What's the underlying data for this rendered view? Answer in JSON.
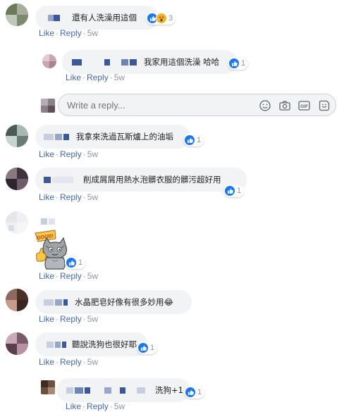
{
  "actions": {
    "like": "Like",
    "reply": "Reply"
  },
  "reply_box": {
    "placeholder": "Write a reply..."
  },
  "colors": {
    "link": "#4267b2",
    "meta": "#90949c",
    "bubble": "#f2f3f5",
    "like_badge": "#1877f2"
  },
  "comments": [
    {
      "text": "還有人洗澡用這個",
      "reaction_count": "3",
      "time": "5w",
      "reactions": [
        "like",
        "wow"
      ]
    },
    {
      "text": "我家用這個洗澡 哈哈",
      "reaction_count": "1",
      "time": "5w",
      "is_reply": true
    },
    {
      "text": "我拿來洗過瓦斯爐上的油垢",
      "reaction_count": "1",
      "time": "5w"
    },
    {
      "text": "削成屑屑用熱水泡髒衣服的髒污超好用",
      "reaction_count": "1",
      "time": "5w"
    },
    {
      "text": "",
      "sticker_text": "GOOD!",
      "reaction_count": "1",
      "time": "5w",
      "sticker": true
    },
    {
      "text": "水晶肥皂好像有很多妙用😂",
      "time": "5w"
    },
    {
      "text": "聽說洗狗也很好耶",
      "reaction_count": "1",
      "time": "5w"
    },
    {
      "text": "洗狗+1",
      "reaction_count": "1",
      "time": "5w",
      "is_reply": true
    }
  ]
}
